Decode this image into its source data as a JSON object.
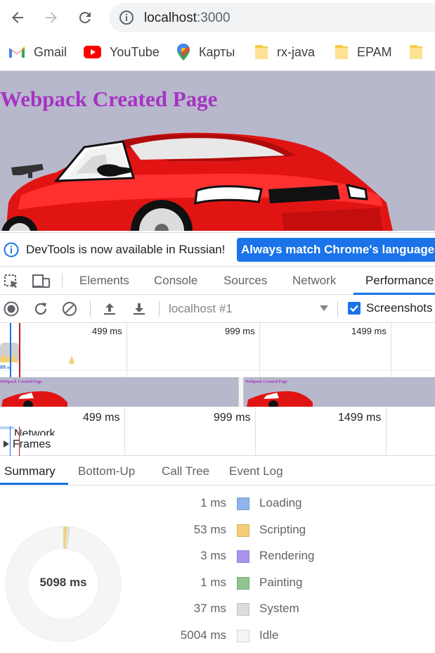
{
  "browser": {
    "url_host": "localhost",
    "url_port": ":3000",
    "bookmarks": [
      {
        "label": "Gmail",
        "icon": "gmail-icon"
      },
      {
        "label": "YouTube",
        "icon": "youtube-icon"
      },
      {
        "label": "Карты",
        "icon": "maps-pin-icon"
      },
      {
        "label": "rx-java",
        "icon": "folder-icon"
      },
      {
        "label": "EPAM",
        "icon": "folder-icon"
      }
    ]
  },
  "page": {
    "heading": "Webpack Created Page",
    "mini_heading": "Webpack Created Page"
  },
  "devtools": {
    "infobar": {
      "message": "DevTools is now available in Russian!",
      "button_label": "Always match Chrome's language"
    },
    "tabs": [
      "Elements",
      "Console",
      "Sources",
      "Network",
      "Performance"
    ],
    "active_tab": "Performance",
    "perf_toolbar": {
      "target": "localhost #1",
      "screenshots_label": "Screenshots",
      "screenshots_checked": true
    },
    "overview_ticks": [
      "499 ms",
      "999 ms",
      "1499 ms"
    ],
    "timeline_ticks": [
      "499 ms",
      "999 ms",
      "1499 ms"
    ],
    "tracks": [
      "Network",
      "Frames"
    ],
    "summary_tabs": [
      "Summary",
      "Bottom-Up",
      "Call Tree",
      "Event Log"
    ],
    "active_summary_tab": "Summary",
    "summary": {
      "total": "5098 ms",
      "rows": [
        {
          "value": "1 ms",
          "label": "Loading",
          "color": "#8fb5ea"
        },
        {
          "value": "53 ms",
          "label": "Scripting",
          "color": "#f2cf74"
        },
        {
          "value": "3 ms",
          "label": "Rendering",
          "color": "#a996ec"
        },
        {
          "value": "1 ms",
          "label": "Painting",
          "color": "#90c38d"
        },
        {
          "value": "37 ms",
          "label": "System",
          "color": "#dcdcdc"
        },
        {
          "value": "5004 ms",
          "label": "Idle",
          "color": "#f5f5f5"
        }
      ]
    }
  }
}
